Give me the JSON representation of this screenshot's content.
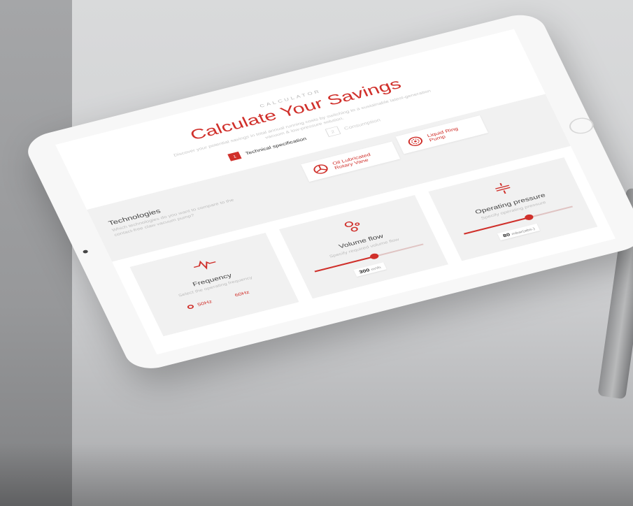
{
  "header": {
    "eyebrow": "CALCULATOR",
    "title": "Calculate Your Savings",
    "description": "Discover your potential savings in total annual running costs by switching to a sustainable latest-generation vacuum & low-pressure solution."
  },
  "steps": [
    {
      "number": "1",
      "label": "Technical specification"
    },
    {
      "number": "2",
      "label": "Consumption"
    }
  ],
  "technologies": {
    "title": "Technologies",
    "description": "Which technologies do you want to compare to the contact-free claw vacuum pump?",
    "options": [
      {
        "label_line1": "Oil Lubricated",
        "label_line2": "Rotary Vane",
        "icon": "rotary-vane-icon"
      },
      {
        "label_line1": "Liquid Ring",
        "label_line2": "Pump",
        "icon": "liquid-ring-icon"
      }
    ]
  },
  "parameters": {
    "frequency": {
      "title": "Frequency",
      "description": "Select the operating frequency",
      "icon": "pulse-icon",
      "options": [
        {
          "label": "50Hz",
          "selected": true
        },
        {
          "label": "60Hz",
          "selected": false
        }
      ]
    },
    "volume_flow": {
      "title": "Volume flow",
      "description": "Specify required volume flow",
      "icon": "bubbles-icon",
      "value": "300",
      "unit": "m³/h",
      "fill_fraction": 0.55
    },
    "operating_pressure": {
      "title": "Operating pressure",
      "description": "Specify operating pressure",
      "icon": "pressure-icon",
      "value": "80",
      "unit": "mbar(abs.)",
      "fill_fraction": 0.6
    }
  },
  "colors": {
    "accent": "#d0302b",
    "panel": "#f1f1f1"
  }
}
